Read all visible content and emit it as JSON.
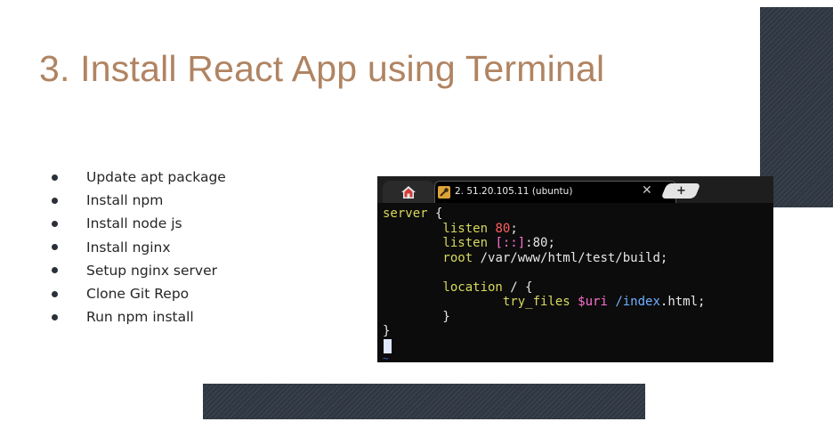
{
  "slide": {
    "title": "3. Install React App using Terminal",
    "bullets": [
      "Update apt package",
      "Install npm",
      "Install node js",
      "Install nginx",
      "Setup nginx server",
      "Clone Git Repo",
      "Run npm install"
    ]
  },
  "terminal": {
    "tabs": [
      {
        "icon": "home-icon"
      },
      {
        "icon": "ssh-key-icon",
        "label": "2. 51.20.105.11 (ubuntu)",
        "close": "✕"
      }
    ],
    "new_tab": "+",
    "lines": {
      "l1": {
        "a": "server",
        "b": " {"
      },
      "l2": {
        "a": "        listen",
        "b": " ",
        "c": "80",
        "d": ";"
      },
      "l3": {
        "a": "        listen",
        "b": " ",
        "c": "[::]",
        "d": ":80;"
      },
      "l4": {
        "a": "        root",
        "b": " /var/www/html/test/build;"
      },
      "l5": {
        "a": "        location",
        "b": " / {"
      },
      "l6": {
        "a": "                try_files",
        "b": " ",
        "c": "$uri",
        "d": " ",
        "e": "/index",
        "f": ".html;"
      },
      "l7": {
        "a": "        }"
      },
      "l8": {
        "a": "}"
      },
      "l9": {
        "a": "~"
      }
    }
  },
  "colors": {
    "title": "#b08462",
    "decoration": "#2f3742",
    "keyword": "#d7d95e",
    "number": "#ff5f5f",
    "variable": "#ff70d0",
    "path": "#6fb0ff"
  }
}
